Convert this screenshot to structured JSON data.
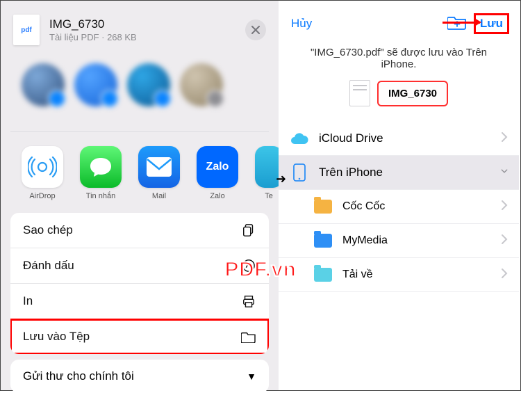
{
  "left": {
    "file": {
      "badge": "pdf",
      "name": "IMG_6730",
      "meta": "Tài liệu PDF · 268 KB"
    },
    "apps": [
      {
        "id": "airdrop",
        "label": "AirDrop"
      },
      {
        "id": "messages",
        "label": "Tin nhắn"
      },
      {
        "id": "mail",
        "label": "Mail"
      },
      {
        "id": "zalo",
        "label": "Zalo",
        "badge": "Zalo"
      },
      {
        "id": "te",
        "label": "Te"
      }
    ],
    "actions": {
      "copy": "Sao chép",
      "markup": "Đánh dấu",
      "print": "In",
      "savefiles": "Lưu vào Tệp"
    },
    "more": "Gửi thư cho chính tôi"
  },
  "right": {
    "cancel": "Hủy",
    "save": "Lưu",
    "message": "\"IMG_6730.pdf\" sẽ được lưu vào Trên iPhone.",
    "filename": "IMG_6730",
    "locations": {
      "icloud": "iCloud Drive",
      "oniphone": "Trên iPhone",
      "children": [
        {
          "id": "coccoc",
          "label": "Cốc Cốc"
        },
        {
          "id": "mymedia",
          "label": "MyMedia"
        },
        {
          "id": "taive",
          "label": "Tải về"
        }
      ]
    }
  },
  "watermark": "PDF.vn"
}
